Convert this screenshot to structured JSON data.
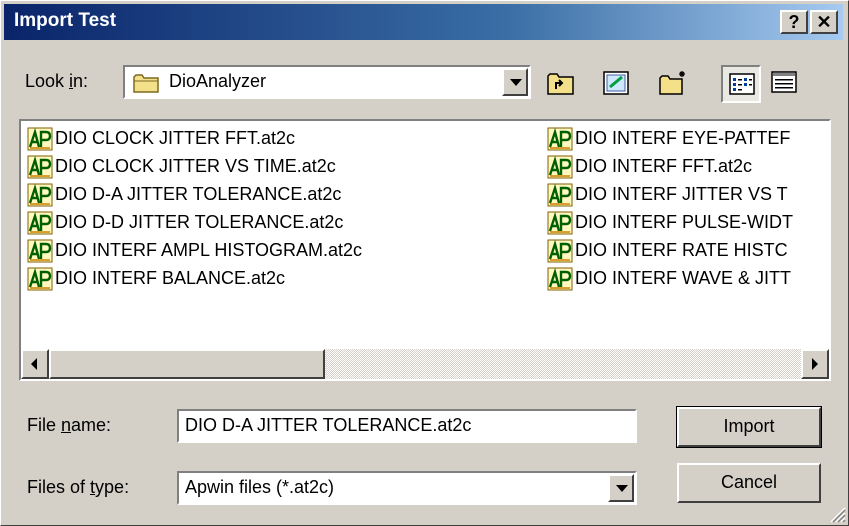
{
  "window": {
    "title": "Import Test",
    "help_button": "?",
    "close_button": "✕"
  },
  "look_in": {
    "label_before": "Look ",
    "label_mnemonic": "i",
    "label_after": "n:",
    "value": "DioAnalyzer",
    "folder_icon": "folder-icon"
  },
  "toolbar": {
    "up_folder": "up-folder-icon",
    "new_folder": "create-new-folder-icon",
    "desktop": "desktop-icon",
    "list_view": "list-view-icon",
    "details_view": "details-view-icon"
  },
  "files": {
    "column1": [
      "DIO CLOCK JITTER FFT.at2c",
      "DIO CLOCK JITTER VS TIME.at2c",
      "DIO D-A JITTER TOLERANCE.at2c",
      "DIO D-D JITTER TOLERANCE.at2c",
      "DIO INTERF AMPL HISTOGRAM.at2c",
      "DIO INTERF BALANCE.at2c"
    ],
    "column2": [
      "DIO INTERF EYE-PATTEF",
      "DIO INTERF FFT.at2c",
      "DIO INTERF JITTER VS T",
      "DIO INTERF PULSE-WIDT",
      "DIO INTERF RATE HISTC",
      "DIO INTERF WAVE & JITT"
    ],
    "icon": "apwin-file-icon"
  },
  "file_name": {
    "label_before": "File ",
    "label_mnemonic": "n",
    "label_after": "ame:",
    "value": "DIO D-A JITTER TOLERANCE.at2c"
  },
  "file_type": {
    "label_before": "Files of ",
    "label_mnemonic": "t",
    "label_after": "ype:",
    "value": "Apwin files (*.at2c)"
  },
  "buttons": {
    "import": "Import",
    "cancel": "Cancel"
  },
  "colors": {
    "title_start": "#0a246a",
    "title_end": "#a6caf0",
    "face": "#d4d0c8"
  }
}
